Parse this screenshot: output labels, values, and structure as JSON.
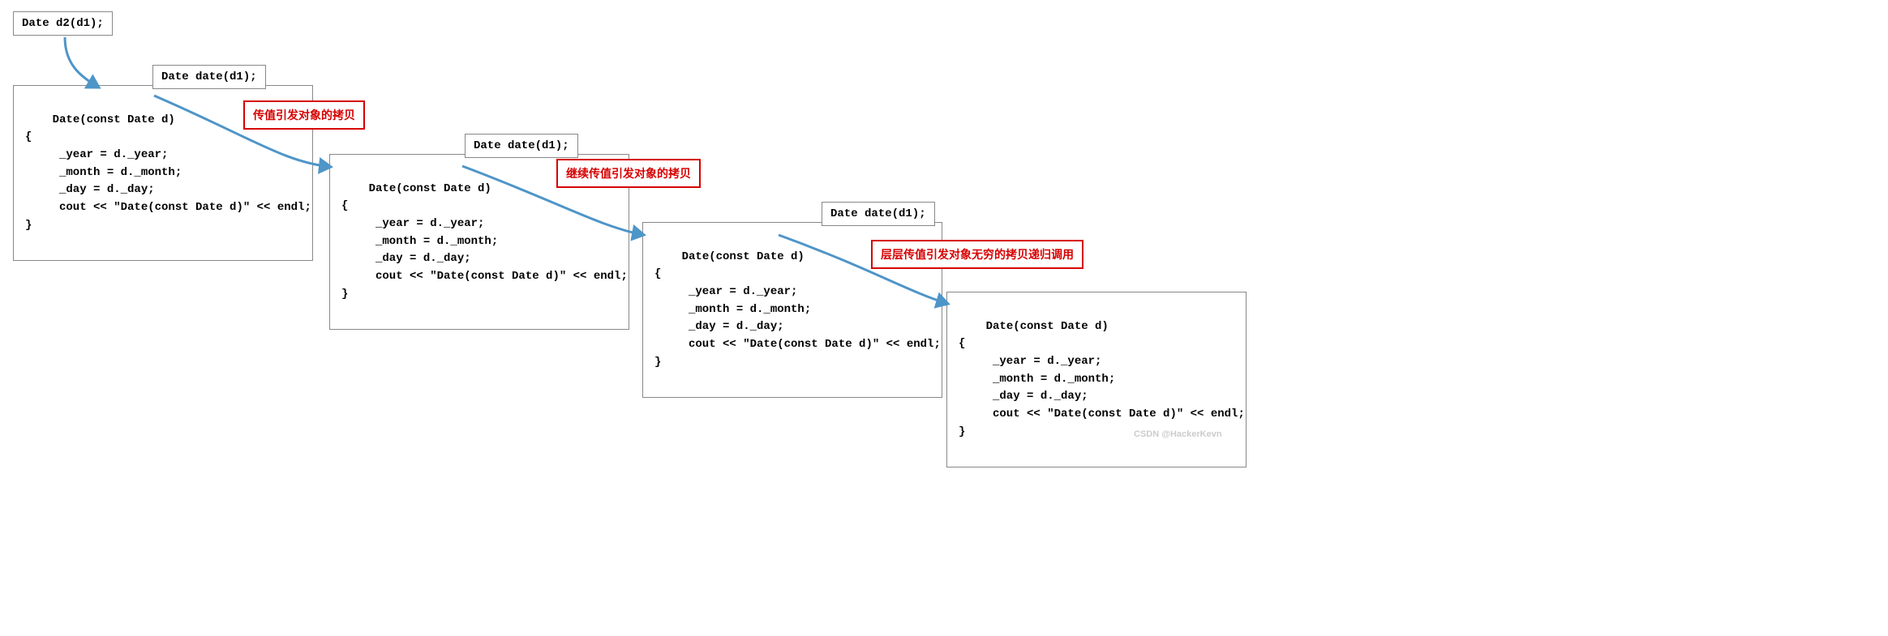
{
  "initial_call": "Date d2(d1);",
  "date_call": "Date date(d1);",
  "func_body": "Date(const Date d)\n{\n     _year = d._year;\n     _month = d._month;\n     _day = d._day;\n     cout << \"Date(const Date d)\" << endl;\n}",
  "annotations": {
    "a1": "传值引发对象的拷贝",
    "a2": "继续传值引发对象的拷贝",
    "a3": "层层传值引发对象无穷的拷贝递归调用"
  },
  "colors": {
    "arrow": "#4e95c8",
    "border_gray": "#888888",
    "red": "#d60000"
  },
  "watermark": "CSDN @HackerKevn"
}
